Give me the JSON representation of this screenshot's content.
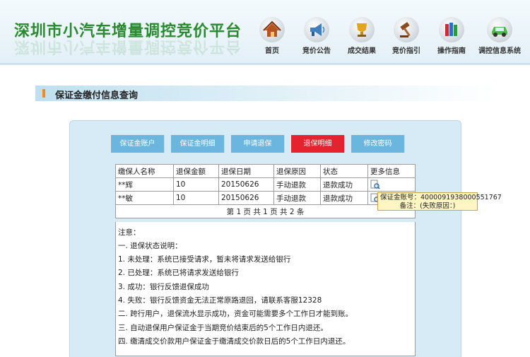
{
  "header": {
    "title": "深圳市小汽车增量调控竞价平台",
    "nav": [
      {
        "label": "首页",
        "icon": "house-icon"
      },
      {
        "label": "竞价公告",
        "icon": "megaphone-icon"
      },
      {
        "label": "成交结果",
        "icon": "trophy-icon"
      },
      {
        "label": "竞价指引",
        "icon": "gavel-icon"
      },
      {
        "label": "操作指南",
        "icon": "books-icon"
      },
      {
        "label": "调控信息系统",
        "icon": "car-icon"
      }
    ]
  },
  "section": {
    "title": "保证金缴付信息查询"
  },
  "tabs": [
    {
      "label": "保证金账户",
      "active": false
    },
    {
      "label": "保证金明细",
      "active": false
    },
    {
      "label": "申请退保",
      "active": false
    },
    {
      "label": "退保明细",
      "active": true
    },
    {
      "label": "修改密码",
      "active": false
    }
  ],
  "table": {
    "headers": [
      "缴保人名称",
      "退保金额",
      "退保日期",
      "退保原因",
      "状态",
      "更多信息"
    ],
    "rows": [
      {
        "name": "**辉",
        "amount": "10",
        "date": "20150626",
        "reason": "手动退款",
        "status": "退款成功"
      },
      {
        "name": "**敏",
        "amount": "10",
        "date": "20150626",
        "reason": "手动退款",
        "status": "退款成功"
      }
    ],
    "pager": "第 1 页 共 1 页 共 2 条"
  },
  "notes": [
    "注意：",
    "一. 退保状态说明：",
    "1. 未处理：系统已接受请求，暂未将请求发送给银行",
    "2. 已处理：系统已将请求发送给银行",
    "3. 成功：银行反馈退保成功",
    "4. 失败：银行反馈资金无法正常原路退回，请联系客服12328",
    "二. 跨行用户，退保流水显示成功，资金可能需要多个工作日才能到账。",
    "三. 自动退保用户保证金于当期竞价结束后的5个工作日内退还。",
    "四. 缴清成交价款用户保证金于缴清成交价款日后的5个工作日内退还。"
  ],
  "tooltip": {
    "line1": "保证金账号：4000091938000551767",
    "line2": "备注：(失败原因：)"
  },
  "colors": {
    "title_green": "#2a8a2f",
    "tab_blue": "#6ab6df",
    "tab_active_red": "#e5232e",
    "accent_orange": "#f08c1c"
  }
}
